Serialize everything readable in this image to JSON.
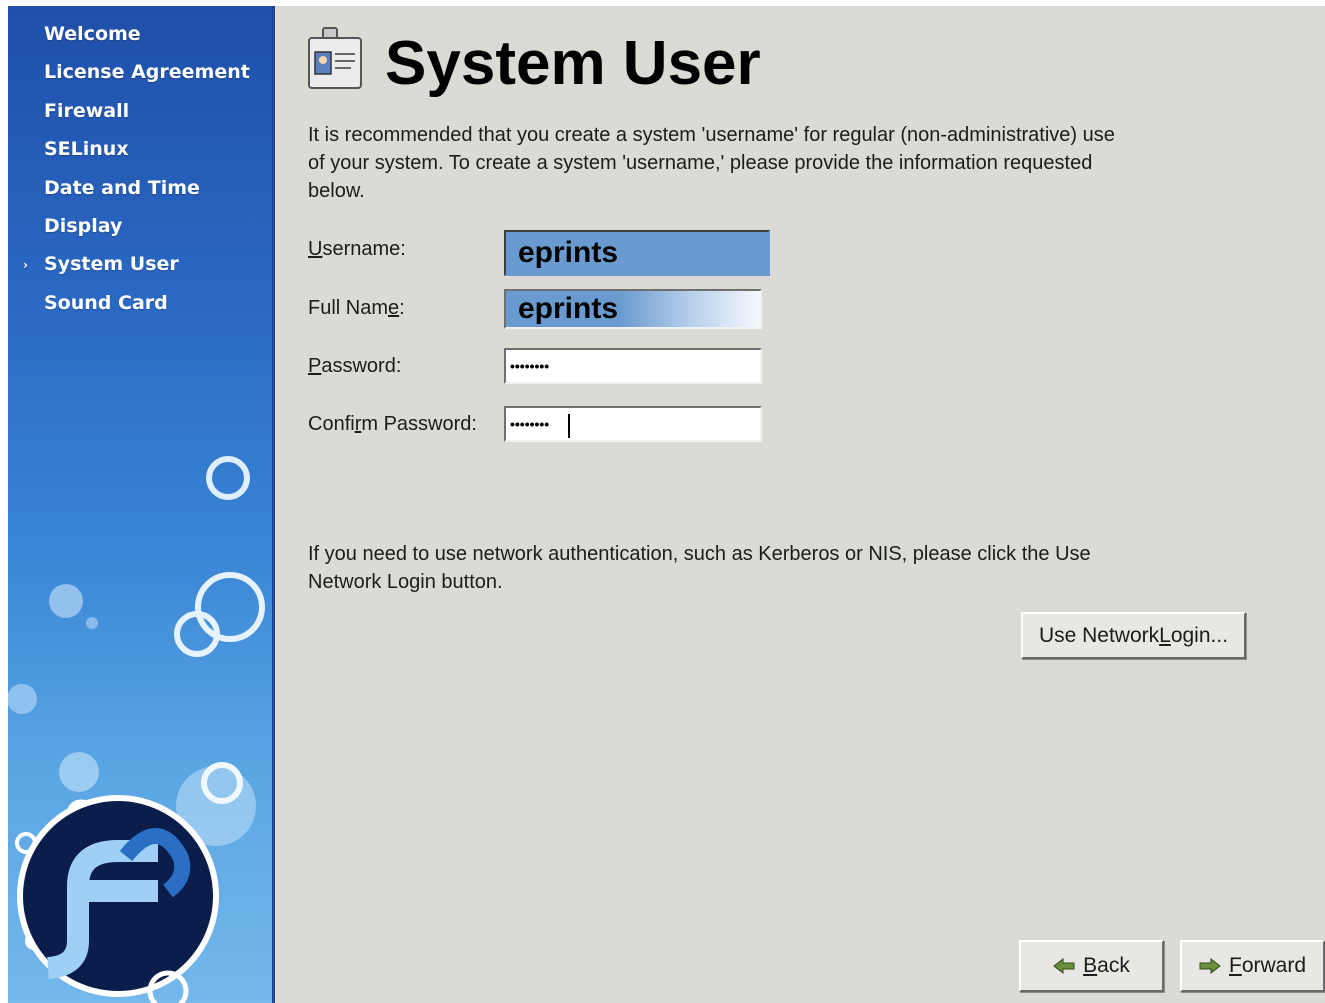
{
  "sidebar": {
    "items": [
      {
        "label": "Welcome",
        "current": false
      },
      {
        "label": "License Agreement",
        "current": false
      },
      {
        "label": "Firewall",
        "current": false
      },
      {
        "label": "SELinux",
        "current": false
      },
      {
        "label": "Date and Time",
        "current": false
      },
      {
        "label": "Display",
        "current": false
      },
      {
        "label": "System User",
        "current": true
      },
      {
        "label": "Sound Card",
        "current": false
      }
    ],
    "current_marker": "›",
    "logo_icon": "fedora-logo-icon",
    "colors": {
      "top": "#1f4fa9",
      "bottom": "#74b8ec"
    }
  },
  "page": {
    "title": "System User",
    "title_icon": "id-badge-icon",
    "intro": "It is recommended that you create a system 'username' for regular (non-administrative) use of your system. To create a system 'username,' please provide the information requested below.",
    "network_text": "If you need to use network authentication, such as Kerberos or NIS, please click the Use Network Login button."
  },
  "form": {
    "username": {
      "label_pre": "",
      "label_key": "U",
      "label_post": "sername:",
      "value": "eprints"
    },
    "fullname": {
      "label_pre": "Full Nam",
      "label_key": "e",
      "label_post": ":",
      "value": "eprints"
    },
    "password": {
      "label_pre": "",
      "label_key": "P",
      "label_post": "assword:",
      "value": "••••••••"
    },
    "confirm": {
      "label_pre": "Confi",
      "label_key": "r",
      "label_post": "m Password:",
      "value": "••••••••"
    }
  },
  "buttons": {
    "network_pre": "Use Network ",
    "network_key": "L",
    "network_post": "ogin...",
    "back_key": "B",
    "back_post": "ack",
    "back_icon": "arrow-left-icon",
    "forward_key": "F",
    "forward_post": "orward",
    "forward_icon": "arrow-right-icon"
  },
  "colors": {
    "content_bg": "#dcdad5",
    "selection": "#6a9bd0"
  }
}
